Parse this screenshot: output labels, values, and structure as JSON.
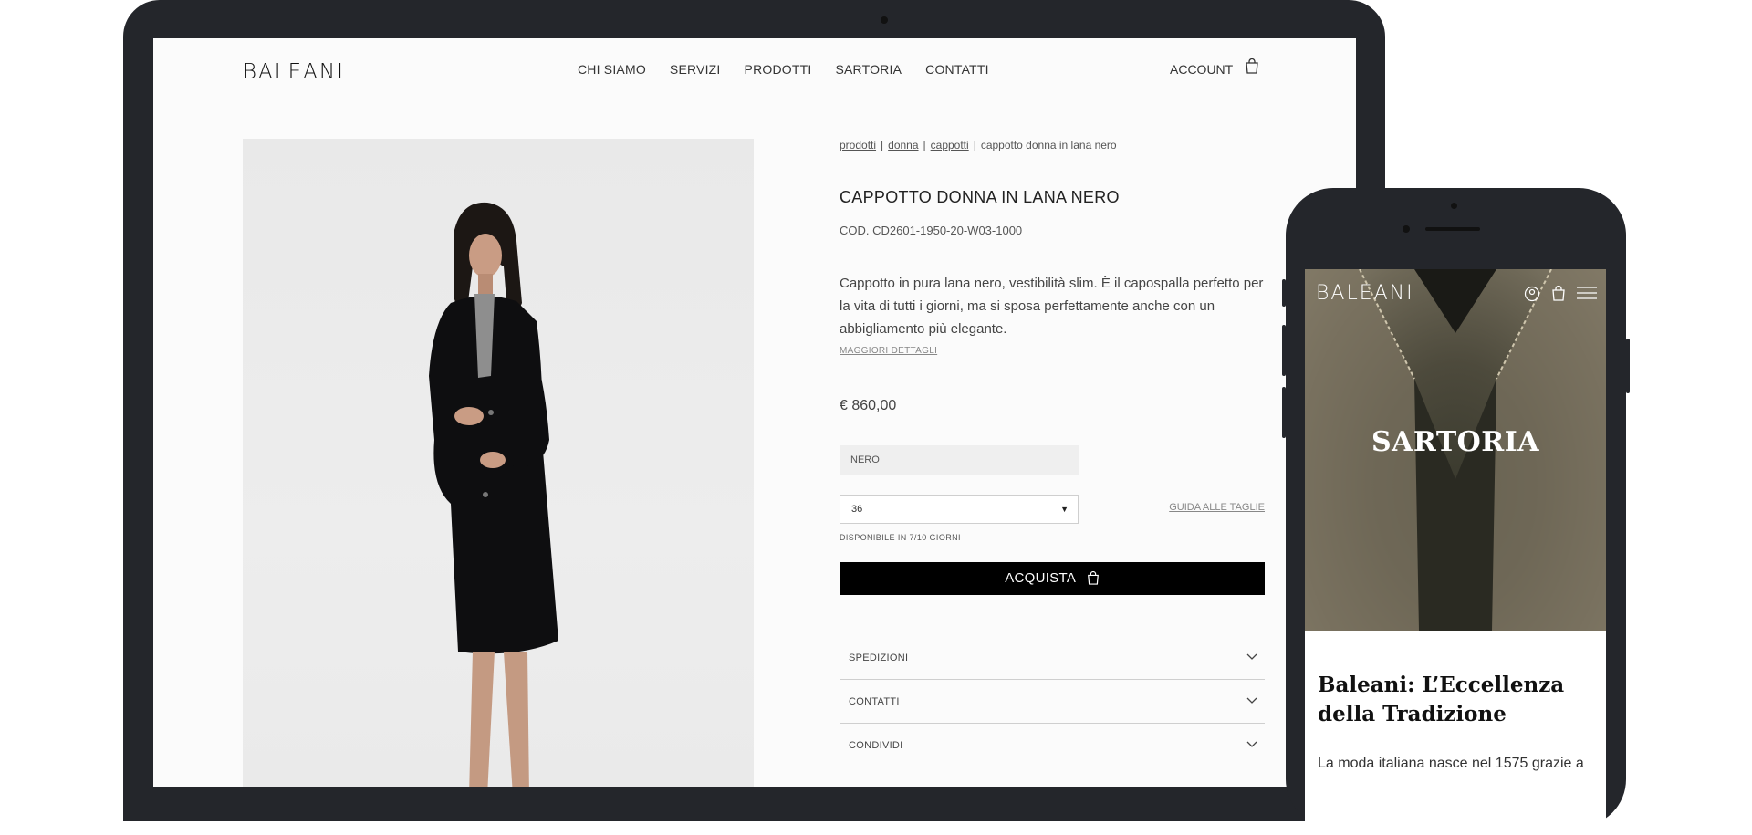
{
  "site": {
    "brand": "BALEANI",
    "nav": [
      "CHI SIAMO",
      "SERVIZI",
      "PRODOTTI",
      "SARTORIA",
      "CONTATTI"
    ],
    "account_label": "ACCOUNT"
  },
  "product": {
    "breadcrumb": {
      "l1": "prodotti",
      "l2": "donna",
      "l3": "cappotti",
      "current": "cappotto donna in lana nero",
      "sep": "|"
    },
    "title": "CAPPOTTO DONNA IN LANA NERO",
    "code": "COD. CD2601-1950-20-W03-1000",
    "description": "Cappotto in pura lana nero, vestibilità slim. È il capospalla perfetto per la vita di tutti i giorni, ma si sposa perfettamente anche con un abbigliamento più elegante.",
    "more_details": "MAGGIORI DETTAGLI",
    "price": "€ 860,00",
    "color": "NERO",
    "size": "36",
    "size_guide": "GUIDA ALLE TAGLIE",
    "availability": "DISPONIBILE IN 7/10 GIORNI",
    "buy_label": "ACQUISTA",
    "accordions": [
      "SPEDIZIONI",
      "CONTATTI",
      "CONDIVIDI"
    ]
  },
  "mobile": {
    "brand": "BALEANI",
    "hero_title": "SARTORIA",
    "heading": "Baleani: L’Eccellenza della Tradizione",
    "body": "La moda italiana nasce nel 1575 grazie a"
  },
  "colors": {
    "laptop_frame": "#24262b",
    "button": "#000000",
    "page_bg": "#fbfbfb"
  }
}
